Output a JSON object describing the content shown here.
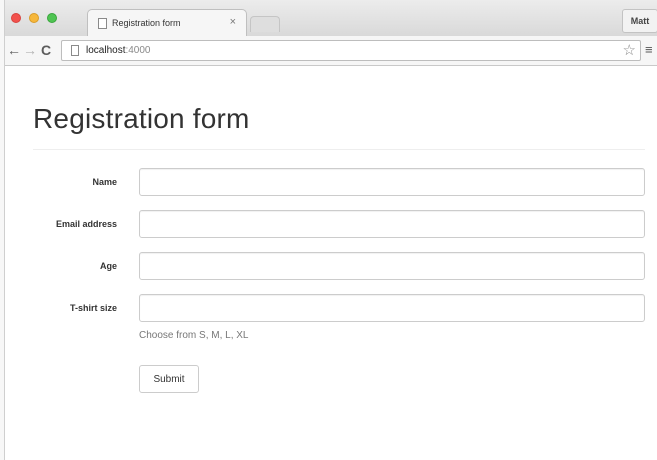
{
  "browser": {
    "tab": {
      "title": "Registration form",
      "close": "×"
    },
    "profile": "Matt",
    "address": {
      "host": "localhost",
      "port": ":4000"
    }
  },
  "page": {
    "title": "Registration form",
    "fields": [
      {
        "label": "Name",
        "value": ""
      },
      {
        "label": "Email address",
        "value": ""
      },
      {
        "label": "Age",
        "value": ""
      },
      {
        "label": "T-shirt size",
        "value": ""
      }
    ],
    "help_text": "Choose from S, M, L, XL",
    "submit_label": "Submit"
  }
}
